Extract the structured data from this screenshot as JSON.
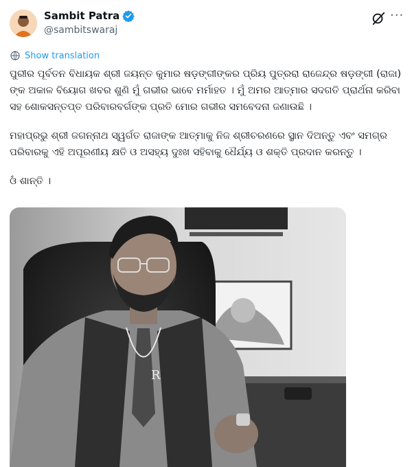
{
  "author": {
    "name": "Sambit Patra",
    "handle": "@sambitswaraj"
  },
  "actions": {
    "grok_icon": "grok-icon",
    "more_label": "···"
  },
  "translate": {
    "label": "Show translation"
  },
  "post": {
    "paragraphs": [
      "ପୁରୀର ପୂର୍ବତନ ବିଧାୟକ ଶ୍ରୀ ଜୟନ୍ତ କୁମାର ଷଡ଼ଙ୍ଗୀଙ୍କର ପ୍ରିୟ ପୁତ୍ରରା ରାଜେନ୍ଦ୍ର ଷଡ଼ଙ୍ଗୀ (ରାଜା) ଙ୍କ ଅକାଳ ବିୟୋଗ ଖବର ଶୁଣି ମୁଁ ଗଭୀର ଭାବେ ମର୍ମାହତ । ମୁଁ ଅମର ଆତ୍ମାର ସଦଗତି ପ୍ରାର୍ଥନା କରିବା ସହ ଶୋକସନ୍ତପ୍ତ ପରିବାରବର୍ଗଙ୍କ ପ୍ରତି ମୋର ଗଭୀର ସମବେଦନା ଜଣାଉଛି ।",
      "ମହାପ୍ରଭୁ ଶ୍ରୀ ଜଗନ୍ନାଥ ସ୍ୱର୍ଗତ ରାଜାଙ୍କ ଆତ୍ମାକୁ ନିଜ ଶ୍ରୀଚରଣରେ ସ୍ଥାନ ଦିଅନ୍ତୁ ଏବଂ ସମଗ୍ର ପରିବାରକୁ ଏହି ଅପୂରଣୀୟ କ୍ଷତି ଓ ଅସହ୍ୟ ଦୁଃଖ ସହିବାକୁ ଧୈର୍ଯ୍ୟ ଓ ଶକ୍ତି ପ୍ରଦାନ କରନ୍ତୁ ।",
      "ଓଁ ଶାନ୍ତି ।"
    ]
  },
  "media": {
    "tag_letter": "R"
  },
  "colors": {
    "link": "#1d9bf0",
    "verified": "#1d9bf0",
    "secondary_text": "#536471"
  }
}
